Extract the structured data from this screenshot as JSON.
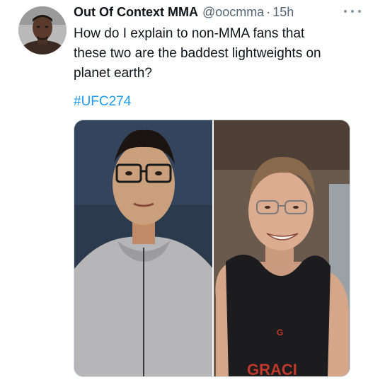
{
  "tweet": {
    "display_name": "Out Of Context MMA",
    "handle": "@oocmma",
    "separator": "·",
    "time": "15h",
    "text": "How do I explain to non-MMA fans that\nthese two are the baddest lightweights on\nplanet earth?",
    "hashtag": "#UFC274"
  },
  "media": {
    "left_photo": "man-with-glasses-grey-hoodie",
    "right_photo": "smiling-man-glasses-black-tank-top",
    "shirt_text": "GRACI",
    "shirt_logo": "G"
  },
  "colors": {
    "link": "#1d9bf0",
    "secondary_text": "#536471",
    "primary_text": "#0f1419"
  }
}
